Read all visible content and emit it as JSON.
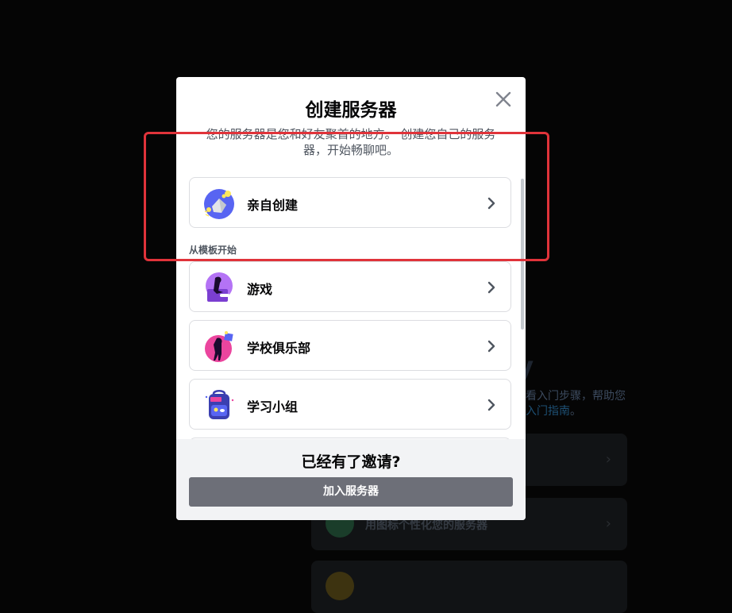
{
  "modal": {
    "title": "创建服务器",
    "subtitle": "您的服务器是您和好友聚首的地方。 创建您自己的服务器，开始畅聊吧。",
    "create_option": {
      "label": "亲自创建",
      "icon": "create-own-icon"
    },
    "section_label": "从模板开始",
    "templates": [
      {
        "label": "游戏",
        "icon": "gaming-icon"
      },
      {
        "label": "学校俱乐部",
        "icon": "school-club-icon"
      },
      {
        "label": "学习小组",
        "icon": "study-group-icon"
      }
    ],
    "footer_title": "已经有了邀请?",
    "join_button": "加入服务器"
  },
  "background": {
    "line1": "看入门步骤，帮助您",
    "line2_link": "入门指南",
    "line2_end": "。",
    "card2_label": "用图标个性化您的服务器"
  },
  "colors": {
    "highlight": "#e0333a",
    "join_button": "#6d6f78",
    "footer_bg": "#f2f3f5"
  }
}
